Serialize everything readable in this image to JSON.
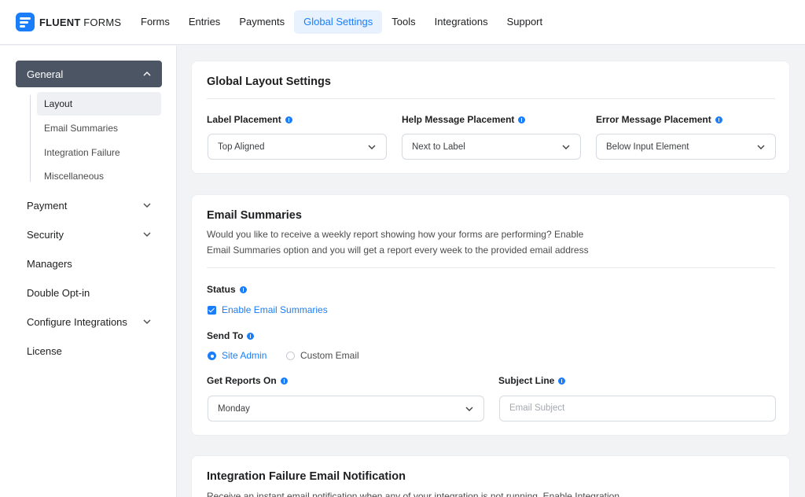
{
  "brand": {
    "name_bold": "FLUENT",
    "name_rest": " FORMS"
  },
  "nav": {
    "items": [
      {
        "label": "Forms"
      },
      {
        "label": "Entries"
      },
      {
        "label": "Payments"
      },
      {
        "label": "Global Settings",
        "active": true
      },
      {
        "label": "Tools"
      },
      {
        "label": "Integrations"
      },
      {
        "label": "Support"
      }
    ]
  },
  "sidebar": {
    "general": {
      "label": "General",
      "expanded": true
    },
    "sub_items": [
      {
        "label": "Layout",
        "active": true
      },
      {
        "label": "Email Summaries"
      },
      {
        "label": "Integration Failure"
      },
      {
        "label": "Miscellaneous"
      }
    ],
    "items": [
      {
        "label": "Payment",
        "has_chevron": true
      },
      {
        "label": "Security",
        "has_chevron": true
      },
      {
        "label": "Managers",
        "has_chevron": false
      },
      {
        "label": "Double Opt-in",
        "has_chevron": false
      },
      {
        "label": "Configure Integrations",
        "has_chevron": true
      },
      {
        "label": "License",
        "has_chevron": false
      }
    ]
  },
  "layout_card": {
    "title": "Global Layout Settings",
    "label_placement": {
      "label": "Label Placement",
      "value": "Top Aligned"
    },
    "help_placement": {
      "label": "Help Message Placement",
      "value": "Next to Label"
    },
    "error_placement": {
      "label": "Error Message Placement",
      "value": "Below Input Element"
    }
  },
  "email_card": {
    "title": "Email Summaries",
    "desc_line1": "Would you like to receive a weekly report showing how your forms are performing? Enable",
    "desc_line2": "Email Summaries option and you will get a report every week to the provided email address",
    "status_label": "Status",
    "enable_label": "Enable Email Summaries",
    "enable_checked": true,
    "send_to_label": "Send To",
    "send_to_options": [
      {
        "label": "Site Admin",
        "selected": true
      },
      {
        "label": "Custom Email",
        "selected": false
      }
    ],
    "reports_on_label": "Get Reports On",
    "reports_on_value": "Monday",
    "subject_label": "Subject Line",
    "subject_placeholder": "Email Subject"
  },
  "failure_card": {
    "title": "Integration Failure Email Notification",
    "desc": "Receive an instant email notification when any of your integration is not running. Enable Integration"
  },
  "colors": {
    "accent": "#1a7efb",
    "sidebar_active": "#4b5563"
  }
}
